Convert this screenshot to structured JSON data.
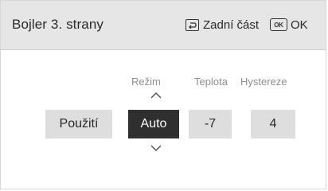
{
  "header": {
    "title": "Bojler 3. strany",
    "back_label": "Zadní část",
    "ok_icon_text": "OK",
    "ok_label": "OK"
  },
  "labels": {
    "mode": "Režim",
    "temperature": "Teplota",
    "hysteresis": "Hystereze"
  },
  "controls": {
    "apply_label": "Použití",
    "mode_value": "Auto",
    "temperature_value": "-7",
    "hysteresis_value": "4"
  },
  "colors": {
    "header_bg": "#e6e6e6",
    "selected_bg": "#2f2f2f",
    "button_bg": "#dedede",
    "label_text": "#8e8e8e"
  }
}
